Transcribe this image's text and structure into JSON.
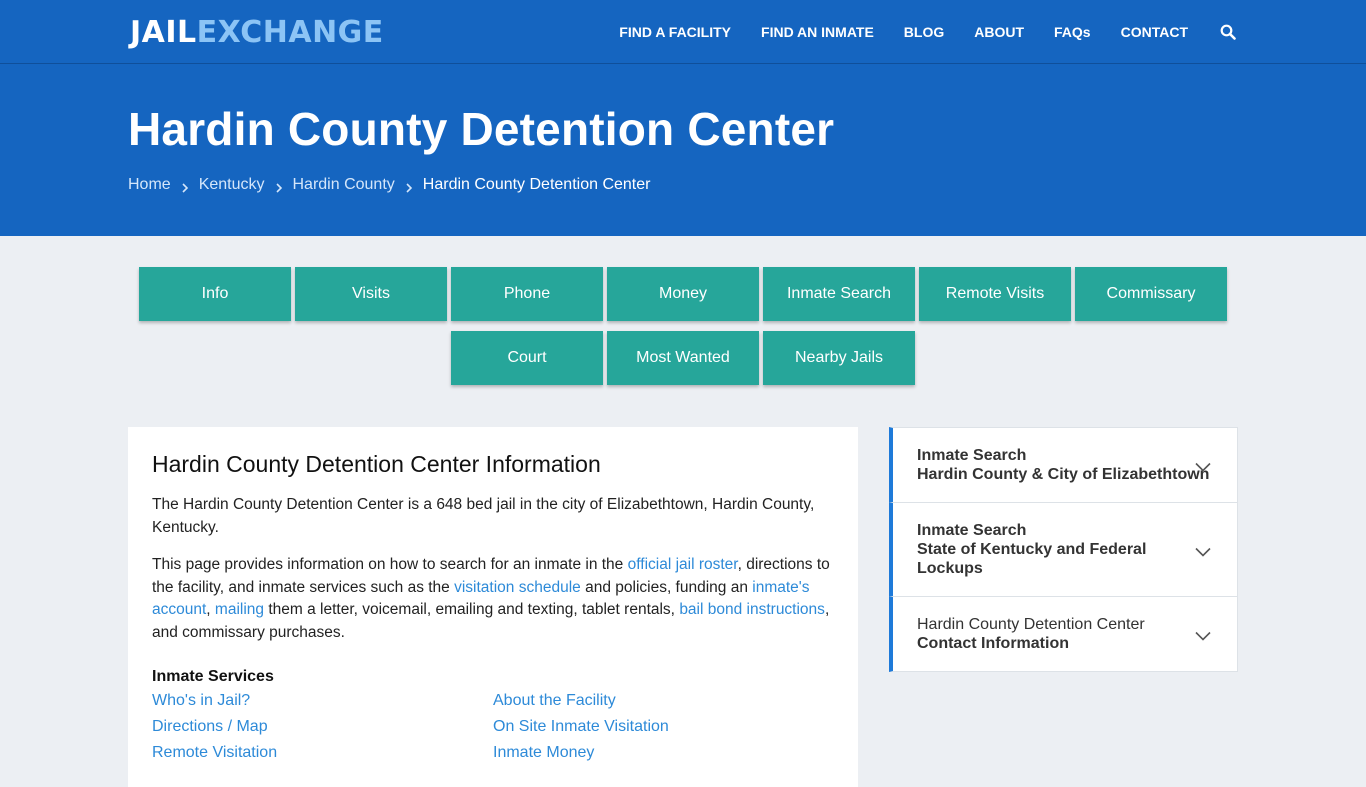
{
  "logo": {
    "part1": "JAIL",
    "part2": "EXCHANGE"
  },
  "nav": {
    "items": [
      "FIND A FACILITY",
      "FIND AN INMATE",
      "BLOG",
      "ABOUT",
      "FAQs",
      "CONTACT"
    ],
    "search_icon": "search-icon"
  },
  "hero": {
    "title": "Hardin County Detention Center",
    "breadcrumb": [
      "Home",
      "Kentucky",
      "Hardin County",
      "Hardin County Detention Center"
    ]
  },
  "tabs": {
    "row1": [
      "Info",
      "Visits",
      "Phone",
      "Money",
      "Inmate Search",
      "Remote Visits",
      "Commissary"
    ],
    "row2": [
      "Court",
      "Most Wanted",
      "Nearby Jails"
    ]
  },
  "main": {
    "heading": "Hardin County Detention Center Information",
    "p1": "The Hardin County Detention Center is a 648 bed jail in the city of Elizabethtown, Hardin County, Kentucky.",
    "p2": {
      "t1": "This page provides information on how to search for an inmate in the ",
      "link1": "official jail roster",
      "t2": ", directions to the facility, and inmate services such as the ",
      "link2": "visitation schedule",
      "t3": " and policies, funding an ",
      "link3": "inmate's account",
      "t4": ", ",
      "link4": "mailing",
      "t5": " them a letter, voicemail, emailing and texting, tablet rentals, ",
      "link5": "bail bond instructions",
      "t6": ", and commissary purchases."
    },
    "services_heading": "Inmate Services",
    "services": [
      "Who's in Jail?",
      "About the Facility",
      "Directions / Map",
      "On Site Inmate Visitation",
      "Remote Visitation",
      "Inmate Money"
    ]
  },
  "sidebar": {
    "items": [
      {
        "line1": "Inmate Search",
        "line2": "Hardin County & City of Elizabethtown"
      },
      {
        "line1": "Inmate Search",
        "line2": "State of Kentucky and Federal Lockups"
      },
      {
        "line1": "Hardin County Detention Center",
        "line2": "Contact Information"
      }
    ]
  },
  "colors": {
    "brand_blue": "#1565c0",
    "teal": "#26a69a",
    "link": "#2d8ad8",
    "accent_border": "#1e7ad9"
  }
}
